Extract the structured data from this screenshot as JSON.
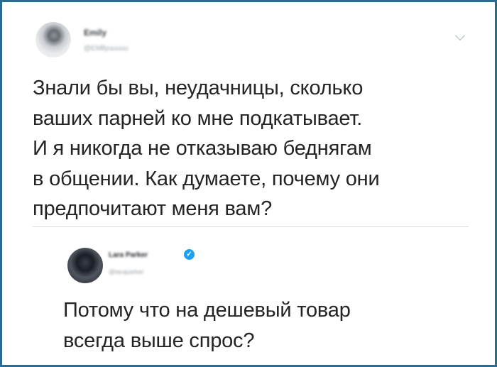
{
  "original_tweet": {
    "author_name": "Emily",
    "author_handle": "@EMllyuuuuu",
    "text": "Знали бы вы, неудачницы, сколько\nваших парней ко мне подкатывает.\nИ я никогда не отказываю беднягам\nв общении. Как думаете, почему они\nпредпочитают меня вам?",
    "menu_icon": "chevron-down-icon",
    "avatar_icon": "user-avatar"
  },
  "reply_tweet": {
    "author_name": "Lara Parker",
    "author_handle": "@laraparker",
    "verified_glyph": "✓",
    "text": "Потому что на дешевый товар\nвсегда выше спрос?",
    "avatar_icon": "user-avatar"
  },
  "colors": {
    "frame_border": "#2b6b8f",
    "text": "#222426",
    "verified": "#1da1f2",
    "divider": "#d5dbe0"
  }
}
